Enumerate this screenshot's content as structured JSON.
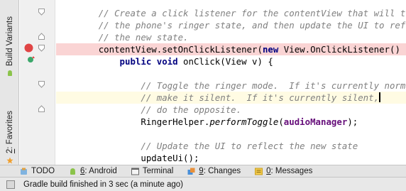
{
  "side_tabs": {
    "build_variants": "Build Variants",
    "favorites_number": "2",
    "favorites_label": ": Favorites"
  },
  "code": {
    "line1": "// Create a click listener for the contentView that will toggle",
    "line2": "// the phone's ringer state, and then update the UI to reflect",
    "line3": "// the new state.",
    "line4_a": "contentView.setOnClickListener(",
    "line4_kw": "new",
    "line4_b": " View.OnClickListener() {",
    "line5_kw": "public void",
    "line5_b": " onClick(View v) {",
    "line7": "// Toggle the ringer mode.  If it's currently normal,",
    "line8": "// make it silent.  If it's currently silent,",
    "line9": "// do the opposite.",
    "line10_a": "RingerHelper.",
    "line10_method": "performToggle",
    "line10_b": "(",
    "line10_field": "audioManager",
    "line10_c": ");",
    "line12": "// Update the UI to reflect the new state",
    "line13": "updateUi();",
    "line14": "}"
  },
  "toolbar": {
    "todo": "TODO",
    "android_num": "6",
    "android_label": ": Android",
    "terminal": "Terminal",
    "changes_num": "9",
    "changes_label": ": Changes",
    "messages_num": "0",
    "messages_label": ": Messages"
  },
  "status": {
    "message": "Gradle build finished in 3 sec (a minute ago)"
  },
  "colors": {
    "breakpoint_line": "#fad4d4",
    "current_line": "#fffbe3",
    "comment": "#808080",
    "keyword": "#000080",
    "field": "#660e7a"
  }
}
